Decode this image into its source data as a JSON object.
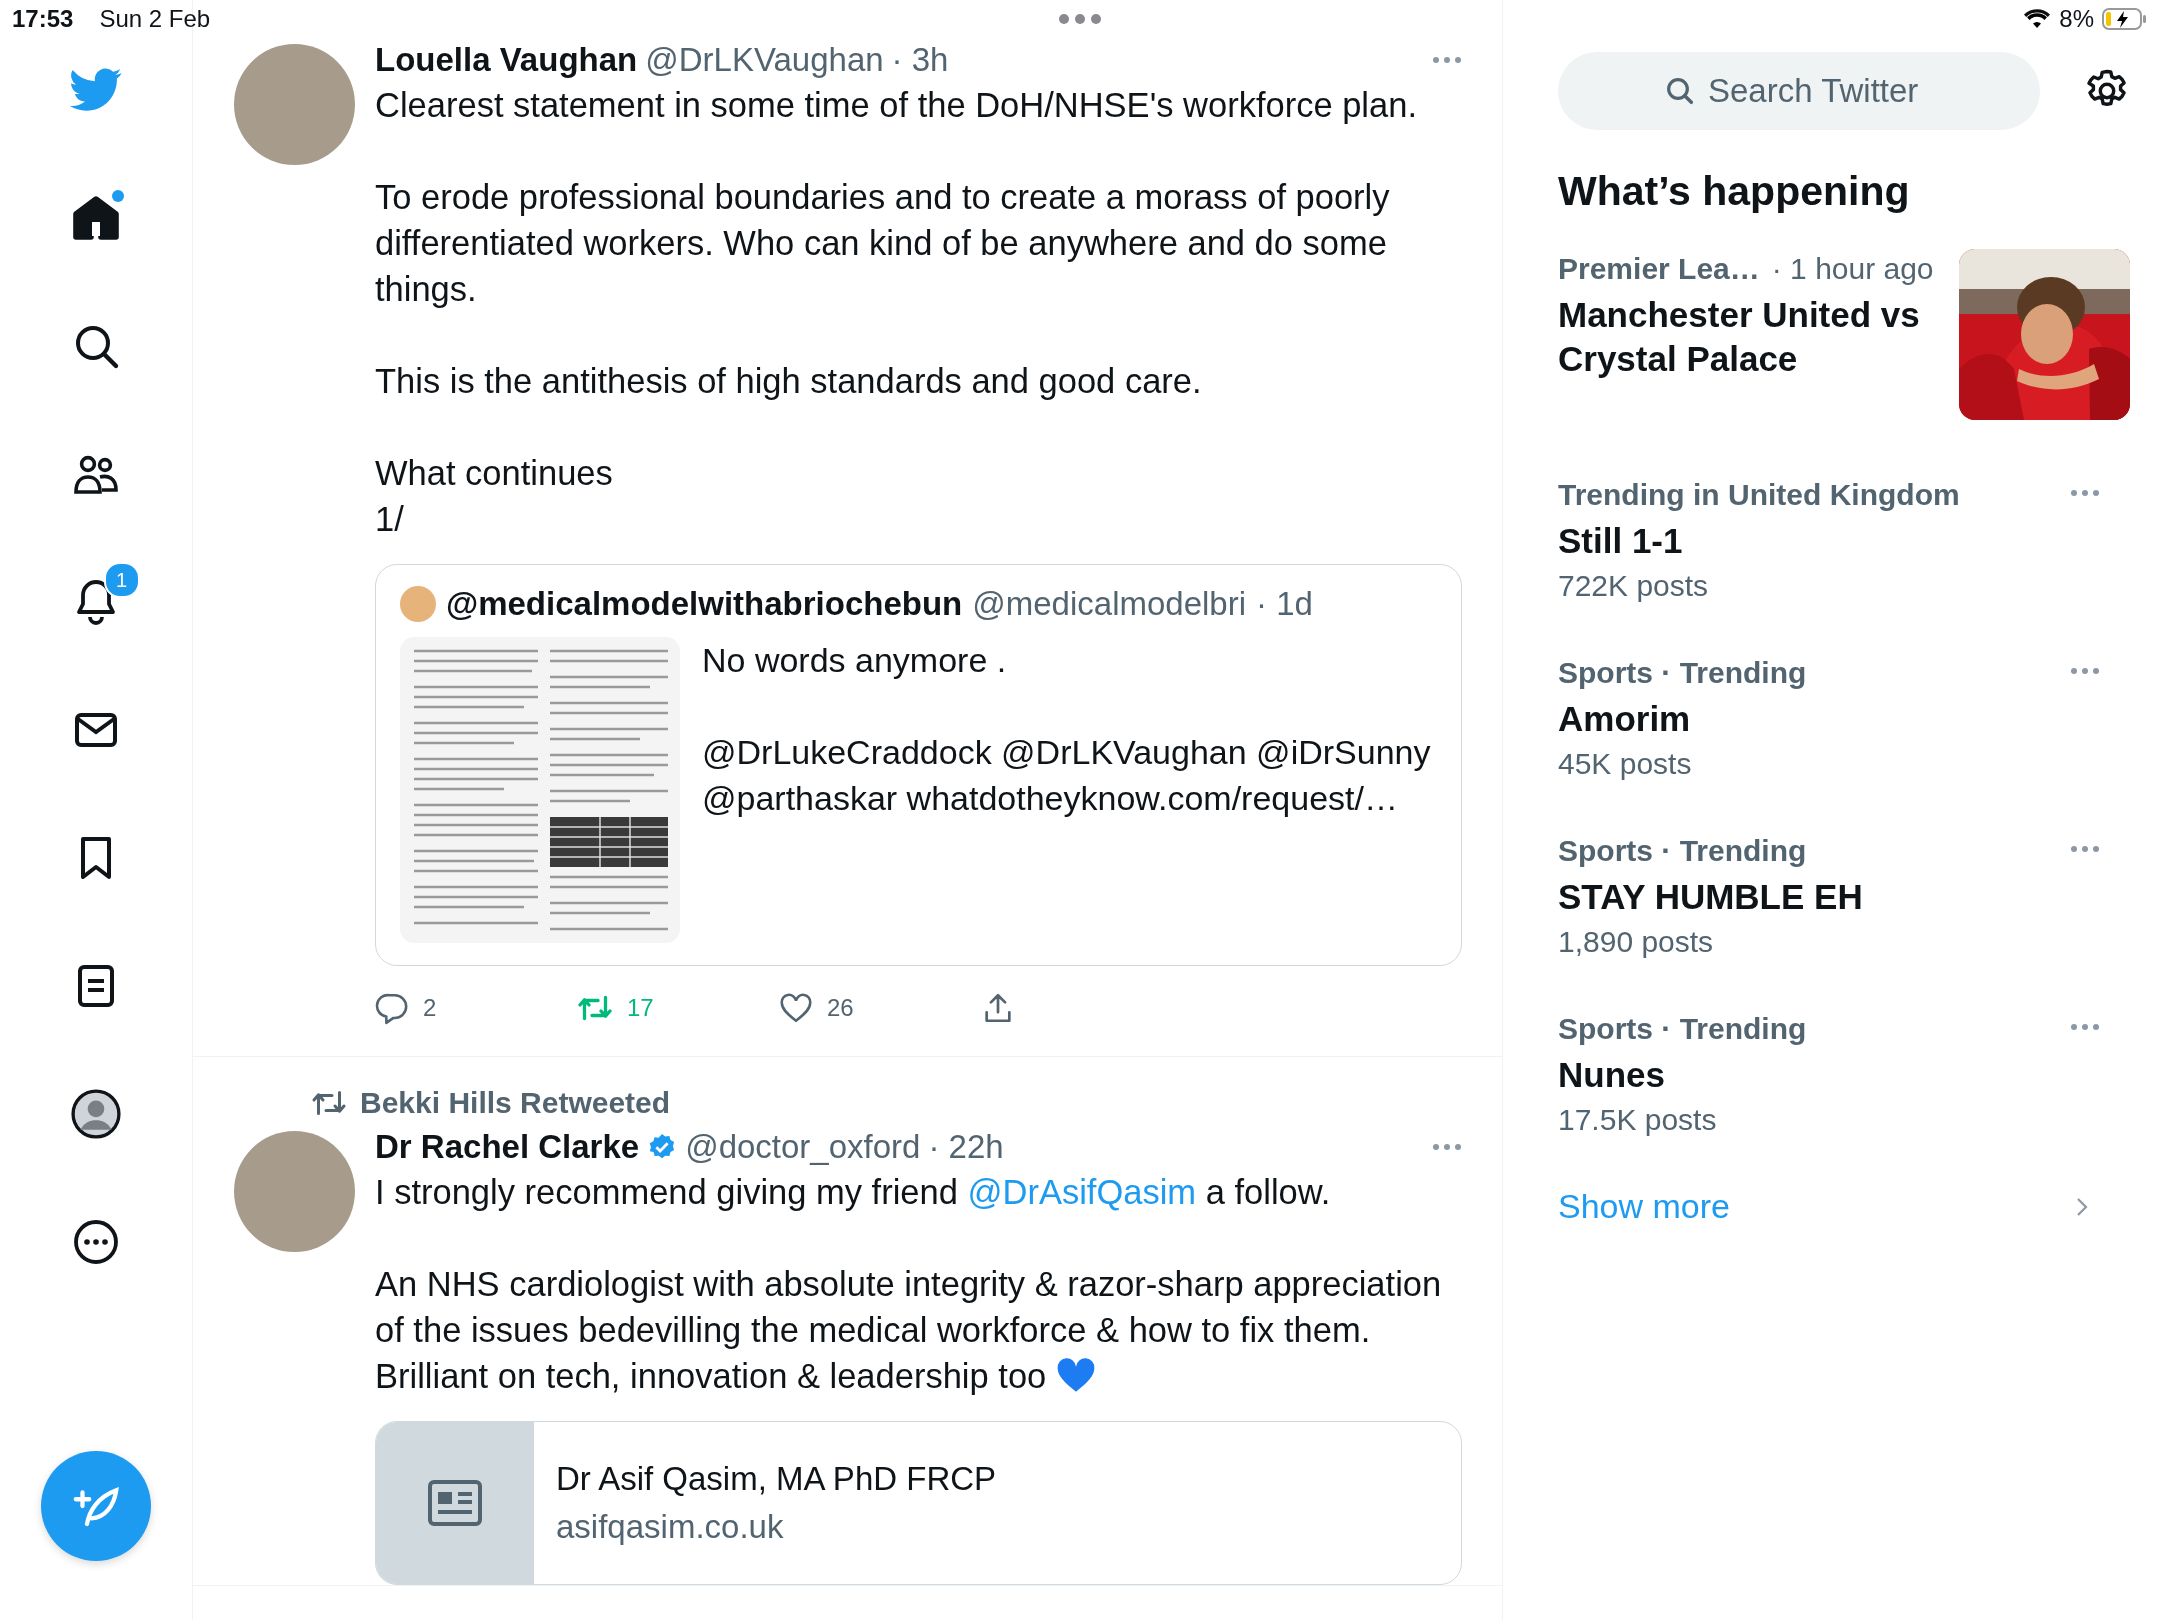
{
  "status_bar": {
    "time": "17:53",
    "date": "Sun 2 Feb",
    "battery": "8%"
  },
  "sidebar": {
    "nav": [
      {
        "kind": "home",
        "selected": true,
        "has_new": true
      },
      {
        "kind": "search",
        "selected": false
      },
      {
        "kind": "communities",
        "selected": false
      },
      {
        "kind": "notifications",
        "selected": false,
        "badge": "1"
      },
      {
        "kind": "messages",
        "selected": false
      },
      {
        "kind": "bookmarks",
        "selected": false
      },
      {
        "kind": "lists",
        "selected": false
      },
      {
        "kind": "profile",
        "selected": false
      },
      {
        "kind": "more",
        "selected": false
      }
    ]
  },
  "tweets": [
    {
      "name": "Louella Vaughan",
      "handle": "@DrLKVaughan",
      "time": "· 3h",
      "paragraphs": [
        {
          "segments": [
            {
              "kind": "text",
              "text": "Clearest statement in some time of the DoH/NHSE's workforce plan."
            }
          ]
        },
        {
          "segments": [
            {
              "kind": "text",
              "text": "To erode professional boundaries and to create a morass of poorly differentiated workers. Who can kind of be anywhere and do some things."
            }
          ]
        },
        {
          "segments": [
            {
              "kind": "text",
              "text": "This is the antithesis of high standards and good care."
            }
          ]
        },
        {
          "segments": [
            {
              "kind": "text",
              "text": "What continues\n1/"
            }
          ]
        }
      ],
      "quote": {
        "name": "@medicalmodelwithabriochebun",
        "handle": "@medicalmodelbri",
        "time": "· 1d",
        "paragraphs": [
          "No words anymore .",
          "@DrLukeCraddock @DrLKVaughan @iDrSunny\n@parthaskar whatdotheyknow.com/request/…"
        ]
      },
      "actions": [
        {
          "kind": "reply",
          "count": "2",
          "selected": false
        },
        {
          "kind": "retweet",
          "count": "17",
          "selected": true
        },
        {
          "kind": "like",
          "count": "26",
          "selected": false
        },
        {
          "kind": "share"
        }
      ]
    },
    {
      "retweeted_by": "Bekki Hills Retweeted",
      "name": "Dr Rachel Clarke",
      "verified": true,
      "handle": "@doctor_oxford",
      "time": "· 22h",
      "paragraphs": [
        {
          "segments": [
            {
              "kind": "text",
              "text": "I strongly recommend giving my friend "
            },
            {
              "kind": "link",
              "text": "@DrAsifQasim"
            },
            {
              "kind": "text",
              "text": " a follow."
            }
          ]
        },
        {
          "segments": [
            {
              "kind": "text",
              "text": "An NHS cardiologist with absolute integrity & razor-sharp appreciation of the issues bedevilling the medical workforce & how to fix them. Brilliant on tech, innovation & leadership too "
            },
            {
              "kind": "heart"
            }
          ]
        }
      ],
      "card": {
        "title": "Dr Asif Qasim, MA PhD FRCP",
        "domain": "asifqasim.co.uk"
      }
    }
  ],
  "right": {
    "search": {
      "placeholder": "Search Twitter"
    },
    "heading": "What’s happening",
    "trends": [
      {
        "kind": "picture",
        "category": "Premier Lea…",
        "time": "· 1 hour ago",
        "title": "Manchester United vs Crystal Palace"
      },
      {
        "kind": "trend",
        "category": "Trending in United Kingdom",
        "title": "Still 1-1",
        "count": "722K posts"
      },
      {
        "kind": "trend",
        "category": "Sports · Trending",
        "title": "Amorim",
        "count": "45K posts"
      },
      {
        "kind": "trend",
        "category": "Sports · Trending",
        "title": "STAY HUMBLE EH",
        "count": "1,890 posts"
      },
      {
        "kind": "trend",
        "category": "Sports · Trending",
        "title": "Nunes",
        "count": "17.5K posts"
      }
    ],
    "show_more": "Show more"
  }
}
